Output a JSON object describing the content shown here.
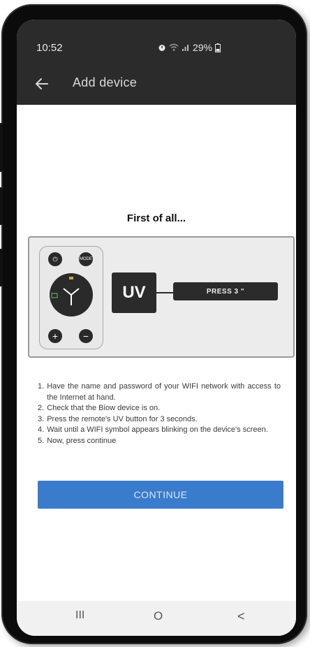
{
  "status_bar": {
    "time": "10:52",
    "icons": [
      "alarm-icon",
      "wifi-icon",
      "signal-icon"
    ],
    "battery": "29%"
  },
  "app_bar": {
    "back_icon": "back-arrow-icon",
    "title": "Add device"
  },
  "heading": "First of all...",
  "illustration": {
    "uv_label": "UV",
    "press_label": "PRESS 3 \""
  },
  "instructions": [
    {
      "num": "1.",
      "text": "Have the name and password of your WIFI network with access to the Internet at hand."
    },
    {
      "num": "2.",
      "text": "Check that the Biow device is on."
    },
    {
      "num": "3.",
      "text": "Press the remote's UV button for 3 seconds."
    },
    {
      "num": "4.",
      "text": "Wait until a WIFI symbol appears blinking on the device's screen."
    },
    {
      "num": "5.",
      "text": "Now, press continue"
    }
  ],
  "continue_label": "CONTINUE",
  "nav_bar": {
    "recents_glyph": "III",
    "home_glyph": "O",
    "back_glyph": "<"
  },
  "colors": {
    "status_bar_bg": "#2b2b2b",
    "button_bg": "#3a7ccc",
    "frame": "#0b0b0b"
  }
}
